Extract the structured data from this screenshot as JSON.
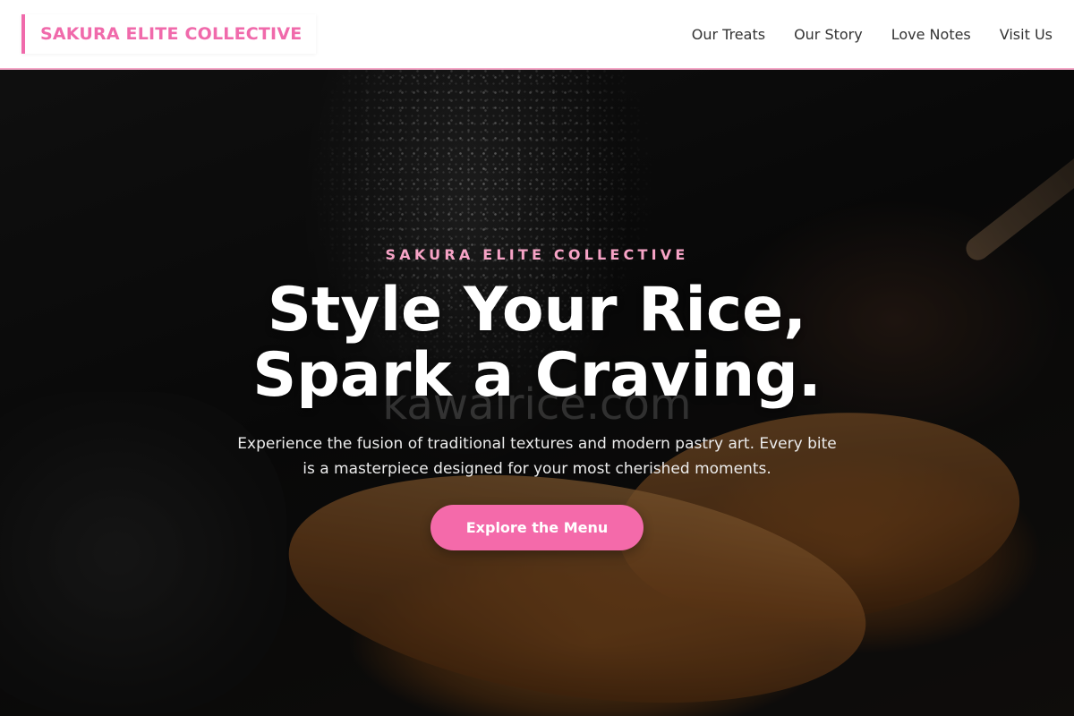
{
  "header": {
    "brand": "SAKURA ELITE COLLECTIVE",
    "nav": [
      {
        "label": "Our Treats"
      },
      {
        "label": "Our Story"
      },
      {
        "label": "Love Notes"
      },
      {
        "label": "Visit Us"
      }
    ]
  },
  "hero": {
    "eyebrow": "SAKURA ELITE COLLECTIVE",
    "headline_line1": "Style Your Rice,",
    "headline_line2": "Spark a Craving.",
    "watermark": "kawairice.com",
    "subtext": "Experience the fusion of traditional textures and modern pastry art. Every bite is a masterpiece designed for your most cherished moments.",
    "cta_label": "Explore the Menu"
  },
  "colors": {
    "accent": "#f06aab",
    "eyebrow": "#f7a3c6",
    "button": "#f46aaa",
    "header_border": "#f5a8c8"
  }
}
